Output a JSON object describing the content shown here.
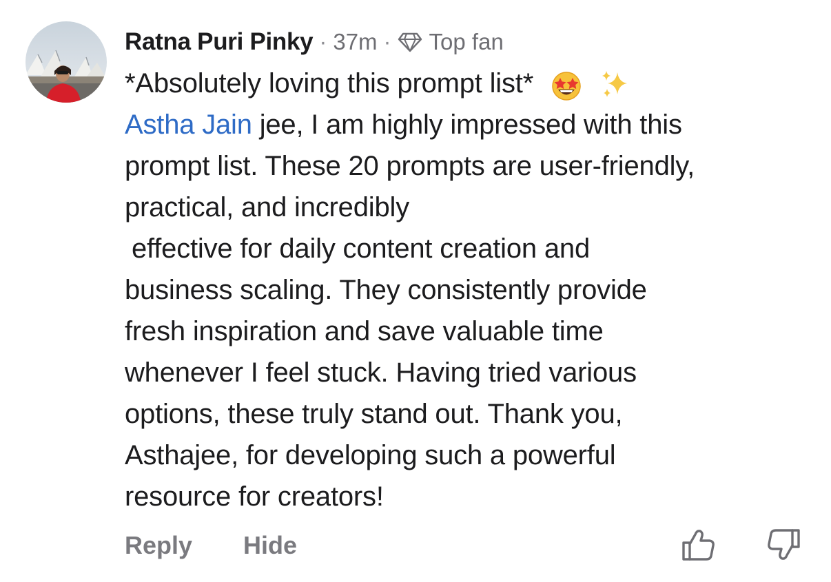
{
  "comment": {
    "author": "Ratna Puri Pinky",
    "separator": "·",
    "time": "37m",
    "badge": {
      "icon": "diamond-icon",
      "label": "Top fan"
    },
    "body": {
      "line1": "*Absolutely loving this prompt list*",
      "line1_emojis": [
        "star-struck-emoji",
        "sparkles-emoji"
      ],
      "mention": "Astha Jain",
      "line2_rest": " jee, I am highly impressed with this",
      "lines": [
        "prompt list. These 20 prompts are user-friendly,",
        "practical, and incredibly",
        "effective for daily content creation and",
        "business scaling. They consistently provide",
        "fresh inspiration and save valuable time",
        "whenever I feel stuck. Having tried various",
        "options, these truly stand out. Thank you,",
        "Asthajee, for developing such a powerful",
        "resource for creators!"
      ]
    },
    "actions": {
      "reply": "Reply",
      "hide": "Hide"
    },
    "icons": {
      "like": "thumbs-up-icon",
      "dislike": "thumbs-down-icon"
    }
  },
  "colors": {
    "mention": "#2e6bc6",
    "secondary_text": "#6e6e73",
    "action_text": "#7a7a7f"
  }
}
